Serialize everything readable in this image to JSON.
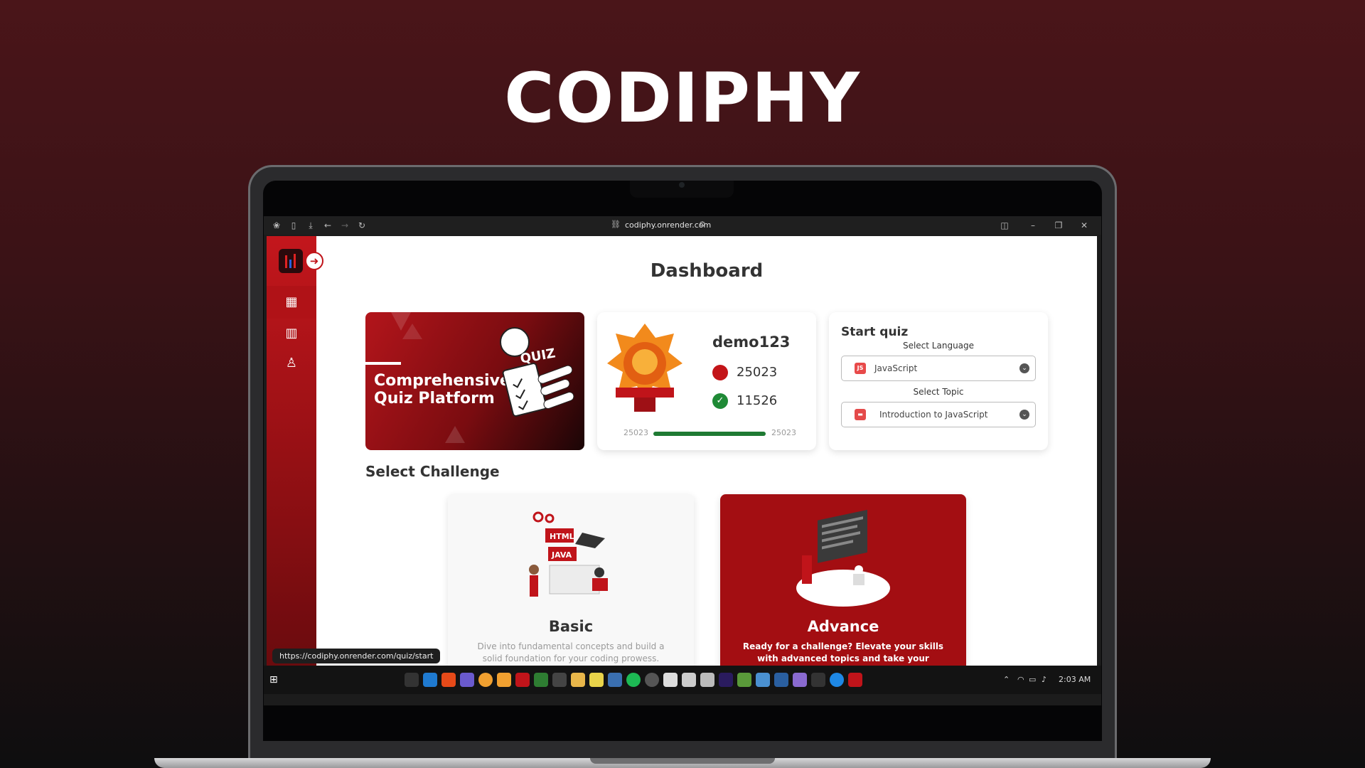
{
  "brand_title": "CODIPHY",
  "browser": {
    "url": "codiphy.onrender.com",
    "status_url": "https://codiphy.onrender.com/quiz/start"
  },
  "dashboard": {
    "title": "Dashboard",
    "banner": {
      "line1": "Comprehensive",
      "line2": "Quiz Platform"
    },
    "profile": {
      "username": "demo123",
      "points": "25023",
      "solved": "11526",
      "progress_left": "25023",
      "progress_right": "25023",
      "progress_fraction": 1.0
    },
    "quiz": {
      "title": "Start quiz",
      "language_label": "Select Language",
      "language_value": "JavaScript",
      "language_icon_text": "JS",
      "topic_label": "Select Topic",
      "topic_value": "Introduction to JavaScript"
    },
    "section_title": "Select Challenge",
    "challenges": [
      {
        "title": "Basic",
        "desc": "Dive into fundamental concepts and build a solid foundation for your coding prowess."
      },
      {
        "title": "Advance",
        "desc": "Ready for a challenge? Elevate your skills with advanced topics and take your programming"
      }
    ]
  },
  "taskbar": {
    "time": "2:03 AM"
  },
  "colors": {
    "accent": "#c0141a",
    "progress": "#1f7a33",
    "advance_card": "#a30e12"
  }
}
